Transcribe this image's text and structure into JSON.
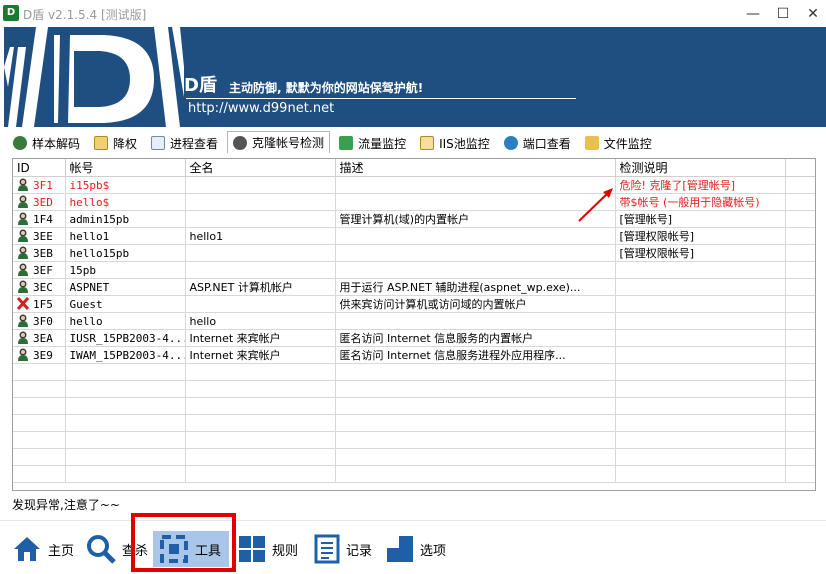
{
  "window": {
    "title": "D盾 v2.1.5.4 [测试版]",
    "app_icon_text": "D",
    "min_glyph": "—",
    "max_glyph": "☐",
    "close_glyph": "✕"
  },
  "banner": {
    "brand": "D盾",
    "slogan": "主动防御, 默默为你的网站保驾护航!",
    "url": "http://www.d99net.net",
    "bg_color": "#1f4e80"
  },
  "tabs": [
    {
      "label": "样本解码",
      "icon": "user-decode-icon",
      "color": "#3a7a3a"
    },
    {
      "label": "降权",
      "icon": "downgrade-icon",
      "color": "#d6a020"
    },
    {
      "label": "进程查看",
      "icon": "process-icon",
      "color": "#6a8ab0"
    },
    {
      "label": "克隆帐号检测",
      "icon": "clone-account-icon",
      "color": "#555555",
      "active": true
    },
    {
      "label": "流量监控",
      "icon": "traffic-icon",
      "color": "#3aa050"
    },
    {
      "label": "IIS池监控",
      "icon": "iis-pool-icon",
      "color": "#e0b040"
    },
    {
      "label": "端口查看",
      "icon": "port-globe-icon",
      "color": "#2a80c0"
    },
    {
      "label": "文件监控",
      "icon": "folder-icon",
      "color": "#e8c050"
    }
  ],
  "table": {
    "columns": [
      "ID",
      "帐号",
      "全名",
      "描述",
      "检测说明"
    ],
    "rows": [
      {
        "id": "3F1",
        "account": "i15pb$",
        "fullname": "",
        "desc": "",
        "note": "危险! 克隆了[管理帐号]",
        "danger": true,
        "icon": "user-icon"
      },
      {
        "id": "3ED",
        "account": "hello$",
        "fullname": "",
        "desc": "",
        "note": "带$帐号 (一般用于隐藏帐号)",
        "danger": true,
        "icon": "user-icon"
      },
      {
        "id": "1F4",
        "account": "admin15pb",
        "fullname": "",
        "desc": "管理计算机(域)的内置帐户",
        "note": "[管理帐号]",
        "danger": false,
        "icon": "user-icon"
      },
      {
        "id": "3EE",
        "account": "hello1",
        "fullname": "hello1",
        "desc": "",
        "note": "[管理权限帐号]",
        "danger": false,
        "icon": "user-icon"
      },
      {
        "id": "3EB",
        "account": "hello15pb",
        "fullname": "",
        "desc": "",
        "note": "[管理权限帐号]",
        "danger": false,
        "icon": "user-icon"
      },
      {
        "id": "3EF",
        "account": "15pb",
        "fullname": "",
        "desc": "",
        "note": "",
        "danger": false,
        "icon": "user-icon"
      },
      {
        "id": "3EC",
        "account": "ASPNET",
        "fullname": "ASP.NET 计算机帐户",
        "desc": "用于运行 ASP.NET 辅助进程(aspnet_wp.exe)...",
        "note": "",
        "danger": false,
        "icon": "user-icon"
      },
      {
        "id": "1F5",
        "account": "Guest",
        "fullname": "",
        "desc": "供来宾访问计算机或访问域的内置帐户",
        "note": "",
        "danger": false,
        "icon": "disabled-user-icon"
      },
      {
        "id": "3F0",
        "account": "hello",
        "fullname": "hello",
        "desc": "",
        "note": "",
        "danger": false,
        "icon": "user-icon"
      },
      {
        "id": "3EA",
        "account": "IUSR_15PB2003-4...",
        "fullname": "Internet 来宾帐户",
        "desc": "匿名访问 Internet 信息服务的内置帐户",
        "note": "",
        "danger": false,
        "icon": "user-icon"
      },
      {
        "id": "3E9",
        "account": "IWAM_15PB2003-4...",
        "fullname": "Internet 来宾帐户",
        "desc": "匿名访问 Internet 信息服务进程外应用程序...",
        "note": "",
        "danger": false,
        "icon": "user-icon"
      }
    ]
  },
  "status": "发现异常,注意了~~",
  "bottom_nav": [
    {
      "label": "主页",
      "icon": "home-icon"
    },
    {
      "label": "查杀",
      "icon": "magnifier-icon"
    },
    {
      "label": "工具",
      "icon": "tools-icon",
      "active": true
    },
    {
      "label": "规则",
      "icon": "rules-grid-icon"
    },
    {
      "label": "记录",
      "icon": "log-icon"
    },
    {
      "label": "选项",
      "icon": "options-icon"
    }
  ],
  "colors": {
    "danger": "#e02020",
    "accent": "#1f5fa8",
    "active_nav": "#a9c6e8",
    "highlight_box": "#e00000"
  }
}
